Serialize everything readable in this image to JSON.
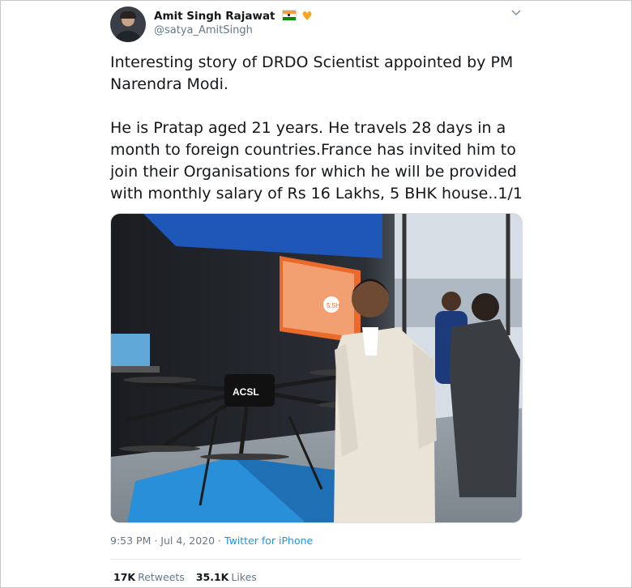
{
  "author": {
    "display_name": "Amit Singh Rajawat",
    "handle": "@satya_AmitSingh",
    "icons": [
      "india-flag-icon",
      "orange-heart-icon"
    ]
  },
  "tweet": {
    "text": "Interesting story of DRDO Scientist appointed by PM\nNarendra Modi.\n\nHe is Pratap aged 21 years. He travels 28 days in a\nmonth to foreign countries.France has invited him to\njoin their Organisations for which he will be provided\nwith monthly salary of Rs 16 Lakhs, 5 BHK house..1/1",
    "image": {
      "brand_text": "ACSL",
      "screen_badge": "5.5H"
    },
    "time": "9:53 PM",
    "separator": " · ",
    "date": "Jul 4, 2020",
    "source": "Twitter for iPhone"
  },
  "stats": {
    "retweets_count": "17K",
    "retweets_label": "Retweets",
    "likes_count": "35.1K",
    "likes_label": "Likes"
  },
  "colors": {
    "link": "#1b95e0",
    "secondary_text": "#657786",
    "primary_text": "#14171a",
    "heart": "#f5a623"
  }
}
